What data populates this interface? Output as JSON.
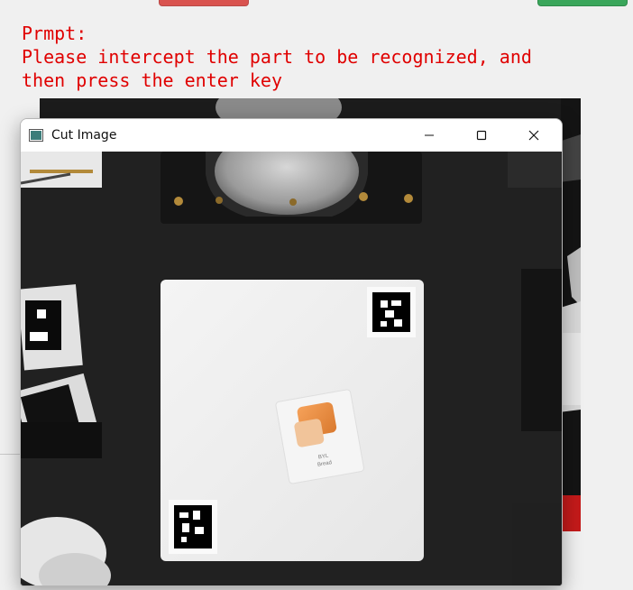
{
  "prompt": {
    "line1": "Prmpt:",
    "line2": "Please intercept the part to be recognized, and",
    "line3": "then press the enter key"
  },
  "window": {
    "title": "Cut Image"
  },
  "card": {
    "line1": "BYL",
    "line2": "Bread"
  },
  "colors": {
    "prompt_text": "#e00000",
    "top_button_left": "#d9534f",
    "top_button_right": "#3aa65b"
  }
}
